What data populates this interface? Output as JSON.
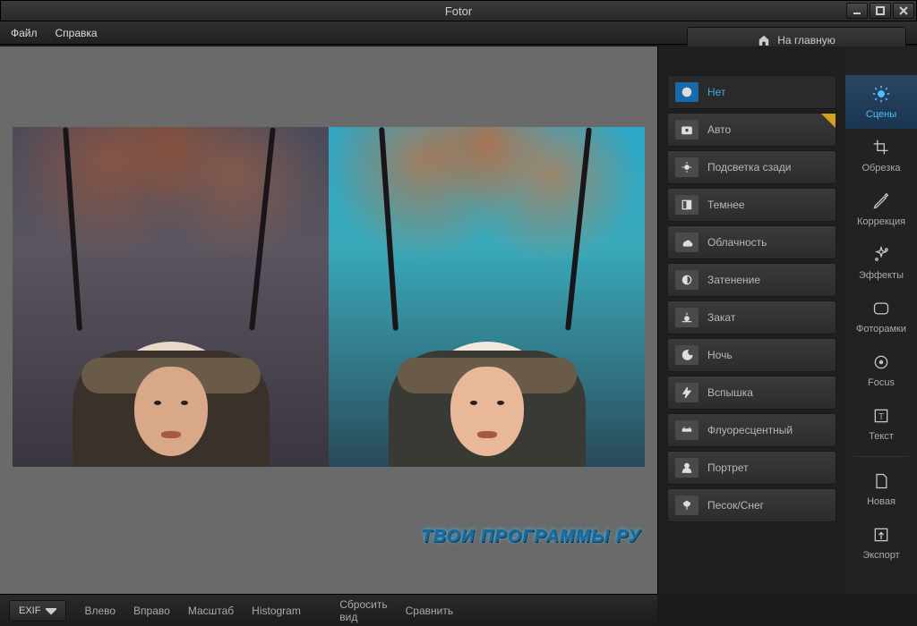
{
  "app": {
    "title": "Fotor"
  },
  "menu": {
    "file": "Файл",
    "help": "Справка"
  },
  "header": {
    "home": "На главную"
  },
  "scenes": [
    {
      "label": "Нет",
      "icon": "none"
    },
    {
      "label": "Авто",
      "icon": "camera",
      "pro": true
    },
    {
      "label": "Подсветка сзади",
      "icon": "backlight"
    },
    {
      "label": "Темнее",
      "icon": "darken"
    },
    {
      "label": "Облачность",
      "icon": "cloud"
    },
    {
      "label": "Затенение",
      "icon": "shade"
    },
    {
      "label": "Закат",
      "icon": "sunset"
    },
    {
      "label": "Ночь",
      "icon": "night"
    },
    {
      "label": "Вспышка",
      "icon": "flash"
    },
    {
      "label": "Флуоресцентный",
      "icon": "fluorescent"
    },
    {
      "label": "Портрет",
      "icon": "portrait"
    },
    {
      "label": "Песок/Снег",
      "icon": "sand"
    }
  ],
  "sidebar": [
    {
      "label": "Сцены",
      "icon": "sun"
    },
    {
      "label": "Обрезка",
      "icon": "crop"
    },
    {
      "label": "Коррекция",
      "icon": "pencil"
    },
    {
      "label": "Эффекты",
      "icon": "sparkle"
    },
    {
      "label": "Фоторамки",
      "icon": "frame"
    },
    {
      "label": "Focus",
      "icon": "focus"
    },
    {
      "label": "Текст",
      "icon": "text"
    }
  ],
  "sidebar2": [
    {
      "label": "Новая",
      "icon": "file"
    },
    {
      "label": "Экспорт",
      "icon": "export"
    }
  ],
  "bottom": {
    "exif": "EXIF",
    "left": "Влево",
    "right": "Вправо",
    "zoom": "Масштаб",
    "hist": "Histogram",
    "reset": "Сбросить вид",
    "compare": "Сравнить"
  },
  "watermark": "ТВОИ ПРОГРАММЫ РУ"
}
